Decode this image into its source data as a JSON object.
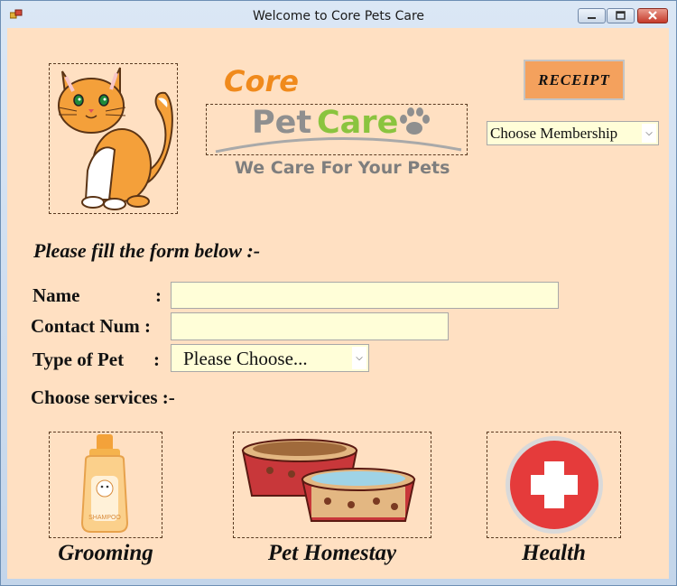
{
  "window": {
    "title": "Welcome to Core Pets Care"
  },
  "logo": {
    "line1": "Core",
    "pet": "Pet",
    "care": "Care",
    "tagline": "We Care For Your Pets"
  },
  "receipt_button": {
    "label": "RECEIPT"
  },
  "membership": {
    "selected": "Choose Membership"
  },
  "form": {
    "heading": "Please fill the form below :-",
    "name_label": "Name",
    "contact_label": "Contact Num :",
    "pet_type_label": "Type of Pet",
    "pet_type_selected": "Please Choose...",
    "colon": ":",
    "name_value": "",
    "contact_value": ""
  },
  "services": {
    "heading": "Choose services  :-",
    "items": [
      {
        "label": "Grooming",
        "icon": "shampoo-bottle-icon"
      },
      {
        "label": "Pet Homestay",
        "icon": "pet-bowls-icon"
      },
      {
        "label": "Health",
        "icon": "medical-cross-icon"
      }
    ],
    "shampoo_text": "SHAMPOO"
  },
  "colors": {
    "background": "#ffe0c2",
    "input_bg": "#fffed8",
    "receipt_bg": "#f4a15d",
    "accent_orange": "#f08a1c",
    "logo_green": "#8ac43f"
  }
}
